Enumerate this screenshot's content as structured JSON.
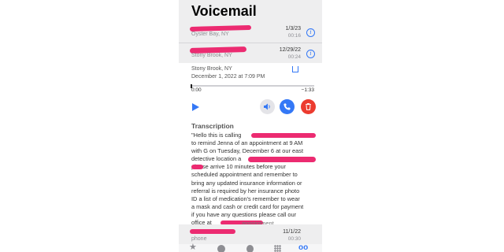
{
  "header": {
    "title": "Voicemail"
  },
  "list": [
    {
      "subtitle": "Oyster Bay, NY",
      "date": "1/3/23",
      "duration": "00:16"
    },
    {
      "subtitle": "Stony Brook, NY",
      "date": "12/29/22",
      "duration": "00:24"
    }
  ],
  "detail": {
    "location": "Stony Brook, NY",
    "timestamp": "December 1, 2022 at 7:09 PM",
    "time_elapsed": "0:00",
    "time_remaining": "−1:33",
    "transcription_heading": "Transcription",
    "transcription_lines": [
      "\"Hello this is                              calling",
      "to remind Jenna of an appointment at 9 AM",
      "with G on Tuesday, December 6 at our east",
      "detective location a",
      "      please arrive 10 minutes before your",
      "scheduled appointment and remember to",
      "bring any updated insurance information or",
      "referral is required by her insurance photo",
      "ID a list of medication's remember to wear",
      "a mask and cash or credit card for payment",
      "if you have any questions please call our",
      "office at"
    ],
    "transcription_tail": "appointment"
  },
  "bottom_row": {
    "subtitle": "phone",
    "date": "11/1/22",
    "duration": "00:30"
  },
  "colors": {
    "accent": "#3478f6",
    "redaction": "#ec2b71",
    "delete": "#ec3b2f"
  }
}
